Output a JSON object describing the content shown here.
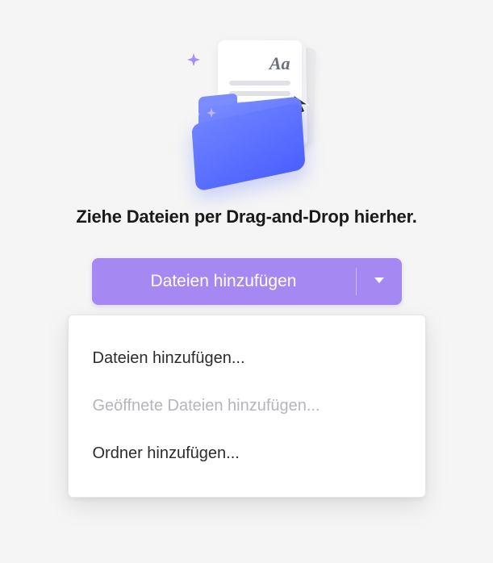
{
  "headline": "Ziehe Dateien per Drag-and-Drop hierher.",
  "illustration": {
    "document_glyph": "Aa"
  },
  "button": {
    "label": "Dateien hinzufügen"
  },
  "menu": {
    "items": [
      {
        "label": "Dateien hinzufügen...",
        "enabled": true
      },
      {
        "label": "Geöffnete Dateien hinzufügen...",
        "enabled": false
      },
      {
        "label": "Ordner hinzufügen...",
        "enabled": true
      }
    ]
  }
}
